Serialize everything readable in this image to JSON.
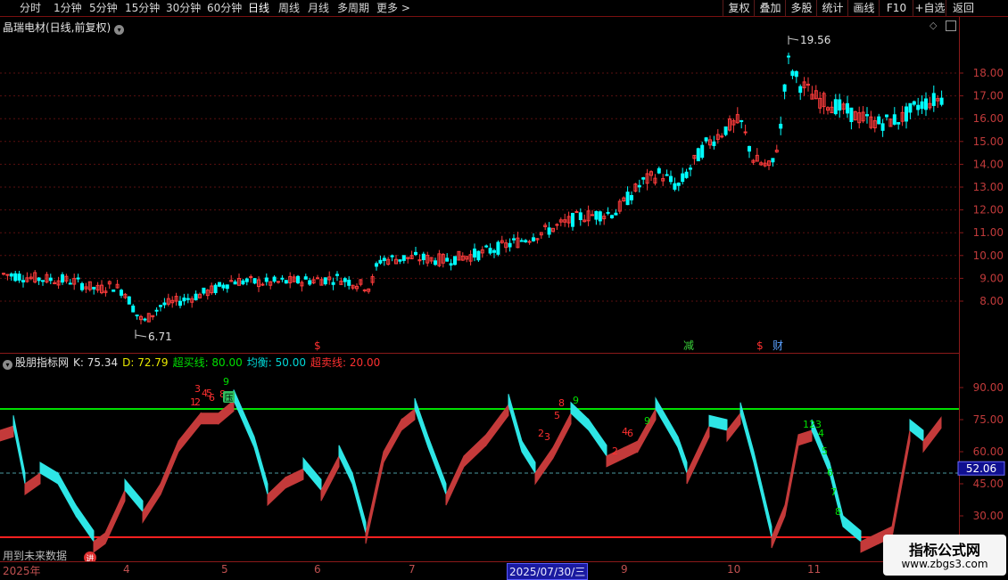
{
  "toolbar": {
    "periods": [
      "分时",
      "1分钟",
      "5分钟",
      "15分钟",
      "30分钟",
      "60分钟",
      "日线",
      "周线",
      "月线",
      "多周期",
      "更多 >"
    ],
    "active_period": "日线",
    "right_buttons": [
      "复权",
      "叠加",
      "多股",
      "统计",
      "画线",
      "F10",
      "+自选",
      "返回"
    ]
  },
  "stock": {
    "title": "晶瑞电材(日线,前复权)",
    "high_label": "19.56",
    "low_label": "6.71"
  },
  "price_axis": {
    "labels": [
      "18.00",
      "17.00",
      "16.00",
      "15.00",
      "14.00",
      "13.00",
      "12.00",
      "11.00",
      "10.00",
      "9.00",
      "8.00"
    ]
  },
  "markers": {
    "reduce": "减",
    "finance": "财",
    "dollar": "$"
  },
  "indicator": {
    "name": "股朋指标网",
    "k_label": "K: 75.34",
    "d_label": "D: 72.79",
    "overbuy_label": "超买线: 80.00",
    "balance_label": "均衡: 50.00",
    "oversell_label": "超卖线: 20.00",
    "axis_labels": [
      "90.00",
      "75.00",
      "60.00",
      "45.00",
      "30.00"
    ],
    "current_value": "52.06",
    "press_marker": "压",
    "buy_marker": "进"
  },
  "footer": {
    "future_note": "用到未来数据",
    "dates": [
      "2025年",
      "4",
      "5",
      "6",
      "7",
      "8",
      "9",
      "10",
      "11"
    ],
    "selected_date": "2025/07/30/三"
  },
  "watermark": {
    "line1": "指标公式网",
    "line2": "www.zbgs3.com"
  },
  "colors": {
    "up": "#ff3c3c",
    "down": "#00ffff",
    "overbuy": "#00e000",
    "oversell": "#ff2020",
    "k_band_up": "#c43a3a",
    "k_band_down": "#2ee6e6"
  }
}
